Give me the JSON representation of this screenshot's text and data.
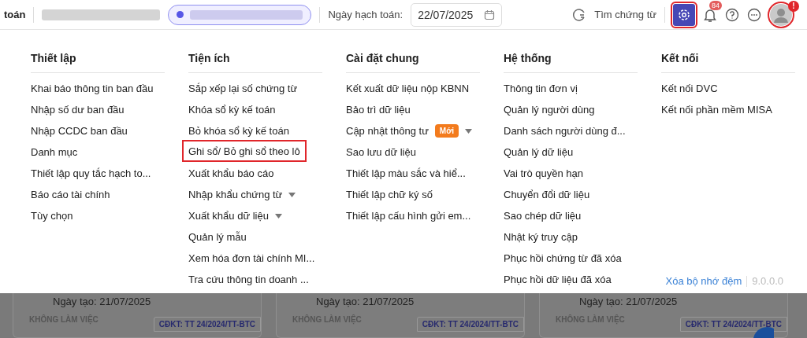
{
  "top_bar": {
    "title_fragment": "toán",
    "date_label": "Ngày hạch toán:",
    "date_value": "22/07/2025",
    "search_label": "Tìm chứng từ",
    "settings_highlighted": true,
    "notification_count": "84",
    "avatar_highlighted": true,
    "avatar_alert": "!"
  },
  "menu": {
    "columns": [
      {
        "title": "Thiết lập",
        "items": [
          {
            "label": "Khai báo thông tin ban đầu",
            "highlighted": false,
            "expandable": false
          },
          {
            "label": "Nhập số dư ban đầu",
            "highlighted": false,
            "expandable": false
          },
          {
            "label": "Nhập CCDC ban đầu",
            "highlighted": false,
            "expandable": false
          },
          {
            "label": "Danh mục",
            "highlighted": false,
            "expandable": false
          },
          {
            "label": "Thiết lập quy tắc hạch to...",
            "highlighted": false,
            "expandable": false
          },
          {
            "label": "Báo cáo tài chính",
            "highlighted": false,
            "expandable": false
          },
          {
            "label": "Tùy chọn",
            "highlighted": false,
            "expandable": false
          }
        ]
      },
      {
        "title": "Tiện ích",
        "items": [
          {
            "label": "Sắp xếp lại số chứng từ",
            "highlighted": false,
            "expandable": false
          },
          {
            "label": "Khóa sổ kỳ kế toán",
            "highlighted": false,
            "expandable": false
          },
          {
            "label": "Bỏ khóa sổ kỳ kế toán",
            "highlighted": false,
            "expandable": false
          },
          {
            "label": "Ghi sổ/ Bỏ ghi sổ theo lô",
            "highlighted": true,
            "expandable": false
          },
          {
            "label": "Xuất khẩu báo cáo",
            "highlighted": false,
            "expandable": false
          },
          {
            "label": "Nhập khẩu chứng từ",
            "highlighted": false,
            "expandable": true
          },
          {
            "label": "Xuất khẩu dữ liệu",
            "highlighted": false,
            "expandable": true
          },
          {
            "label": "Quản lý mẫu",
            "highlighted": false,
            "expandable": false
          },
          {
            "label": "Xem hóa đơn tài chính MI...",
            "highlighted": false,
            "expandable": false
          },
          {
            "label": "Tra cứu thông tin doanh ...",
            "highlighted": false,
            "expandable": false
          }
        ]
      },
      {
        "title": "Cài đặt chung",
        "items": [
          {
            "label": "Kết xuất dữ liệu nộp KBNN",
            "highlighted": false,
            "expandable": false
          },
          {
            "label": "Bảo trì dữ liệu",
            "highlighted": false,
            "expandable": false
          },
          {
            "label": "Cập nhật thông tư",
            "highlighted": false,
            "expandable": true,
            "badge": "Mới"
          },
          {
            "label": "Sao lưu dữ liệu",
            "highlighted": false,
            "expandable": false
          },
          {
            "label": "Thiết lập màu sắc và hiể...",
            "highlighted": false,
            "expandable": false
          },
          {
            "label": "Thiết lập chữ ký số",
            "highlighted": false,
            "expandable": false
          },
          {
            "label": "Thiết lập cấu hình gửi em...",
            "highlighted": false,
            "expandable": false
          }
        ]
      },
      {
        "title": "Hệ thống",
        "items": [
          {
            "label": "Thông tin đơn vị",
            "highlighted": false,
            "expandable": false
          },
          {
            "label": "Quản lý người dùng",
            "highlighted": false,
            "expandable": false
          },
          {
            "label": "Danh sách người dùng đ...",
            "highlighted": false,
            "expandable": false
          },
          {
            "label": "Quản lý dữ liệu",
            "highlighted": false,
            "expandable": false
          },
          {
            "label": "Vai trò quyền hạn",
            "highlighted": false,
            "expandable": false
          },
          {
            "label": "Chuyển đổi dữ liệu",
            "highlighted": false,
            "expandable": false
          },
          {
            "label": "Sao chép dữ liệu",
            "highlighted": false,
            "expandable": false
          },
          {
            "label": "Nhật ký truy cập",
            "highlighted": false,
            "expandable": false
          },
          {
            "label": "Phục hồi chứng từ đã xóa",
            "highlighted": false,
            "expandable": false
          },
          {
            "label": "Phục hồi dữ liệu đã xóa",
            "highlighted": false,
            "expandable": false
          }
        ]
      },
      {
        "title": "Kết nối",
        "items": [
          {
            "label": "Kết nối DVC",
            "highlighted": false,
            "expandable": false
          },
          {
            "label": "Kết nối phần mềm MISA",
            "highlighted": false,
            "expandable": false
          }
        ]
      }
    ],
    "footer": {
      "link": "Xóa bộ nhớ đệm",
      "version": "9.0.0.0"
    }
  },
  "cards": [
    {
      "date": "Ngày tạo: 21/07/2025",
      "status": "KHÔNG LÀM VIỆC",
      "tag": "CĐKT: TT 24/2024/TT-BTC"
    },
    {
      "date": "Ngày tạo: 21/07/2025",
      "status": "KHÔNG LÀM VIỆC",
      "tag": "CĐKT: TT 24/2024/TT-BTC"
    },
    {
      "date": "Ngày tạo: 21/07/2025",
      "status": "KHÔNG LÀM VIỆC",
      "tag": "CĐKT: TT 24/2024/TT-BTC"
    }
  ]
}
